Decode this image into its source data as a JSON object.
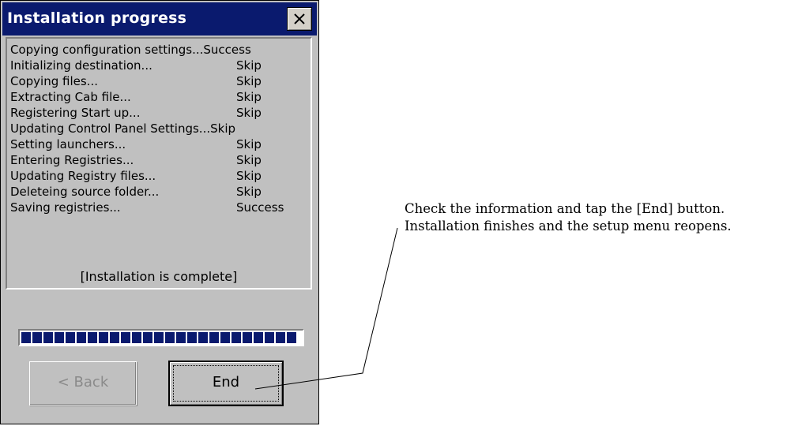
{
  "dialog": {
    "title": "Installation progress",
    "log": [
      {
        "label": "Copying configuration settings...Success",
        "status": ""
      },
      {
        "label": "Initializing destination...",
        "status": "Skip"
      },
      {
        "label": "Copying files...",
        "status": "Skip"
      },
      {
        "label": "Extracting Cab file...",
        "status": "Skip"
      },
      {
        "label": "Registering Start up...",
        "status": "Skip"
      },
      {
        "label": "Updating Control Panel Settings...Skip",
        "status": ""
      },
      {
        "label": "Setting launchers...",
        "status": "Skip"
      },
      {
        "label": "Entering Registries...",
        "status": "Skip"
      },
      {
        "label": "Updating Registry files...",
        "status": "Skip"
      },
      {
        "label": "Deleteing source folder...",
        "status": "Skip"
      },
      {
        "label": "Saving registries...",
        "status": "Success"
      }
    ],
    "completion_text": "[Installation is complete]",
    "progress": 1.0,
    "back_label": "< Back",
    "end_label": "End"
  },
  "annotation": {
    "line1": "Check the information and tap the [End] button.",
    "line2": "Installation finishes and the setup menu reopens."
  },
  "colors": {
    "titlebar": "#0a1a6e",
    "dialog_bg": "#c0c0c0"
  }
}
